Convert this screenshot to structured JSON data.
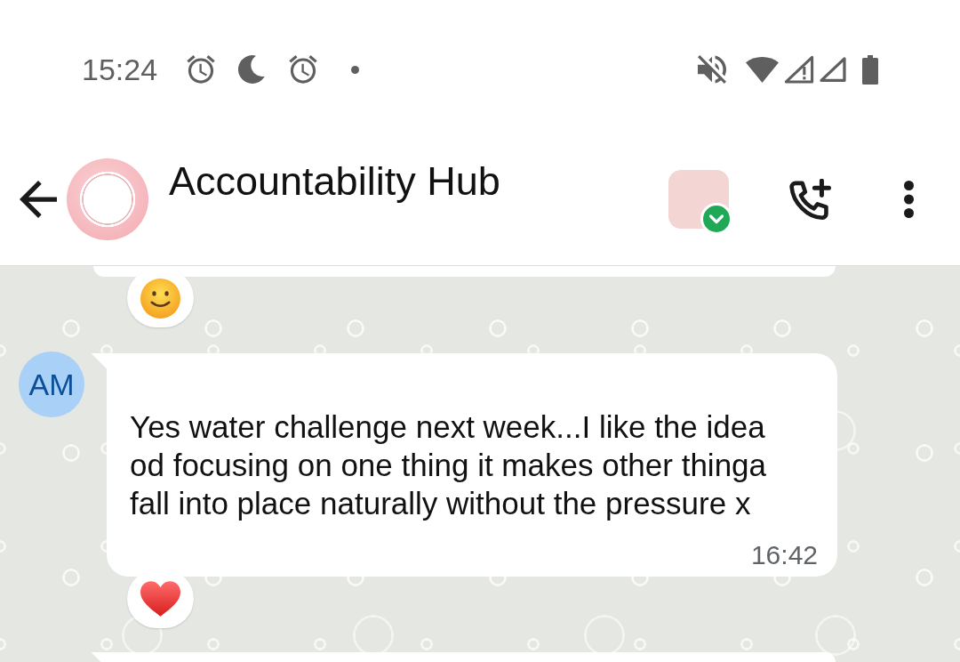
{
  "status_bar": {
    "time": "15:24"
  },
  "header": {
    "title": "Accountability Hub"
  },
  "messages": [
    {
      "kind": "partial_top",
      "reaction": {
        "kind": "smiley"
      }
    },
    {
      "kind": "full",
      "avatar": "AM",
      "text": "Yes water challenge next week...I like the idea od focusing on one thing it makes other thinga fall into place naturally without the pressure x",
      "time": "16:42",
      "reaction": {
        "kind": "heart"
      }
    },
    {
      "kind": "partial_bottom"
    }
  ]
}
